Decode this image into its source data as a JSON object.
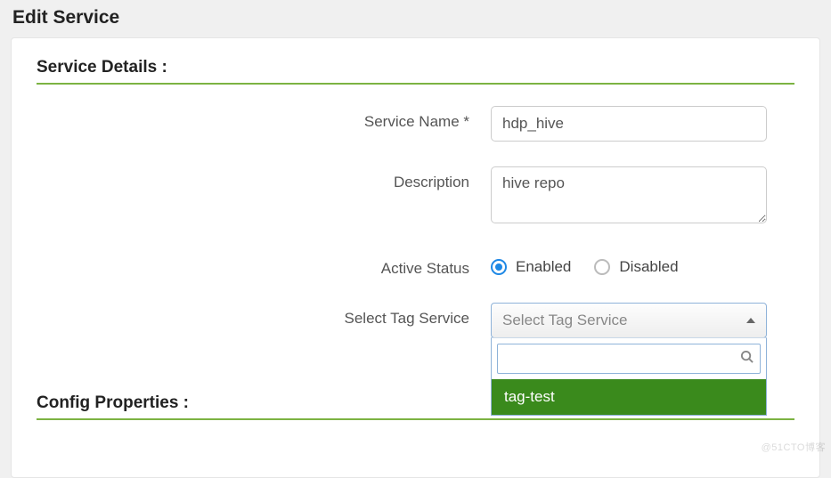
{
  "page": {
    "title": "Edit Service"
  },
  "sections": {
    "details_title": "Service Details :",
    "config_title": "Config Properties :"
  },
  "form": {
    "service_name": {
      "label": "Service Name *",
      "value": "hdp_hive"
    },
    "description": {
      "label": "Description",
      "value": "hive repo"
    },
    "active_status": {
      "label": "Active Status",
      "enabled_label": "Enabled",
      "disabled_label": "Disabled",
      "value": "enabled"
    },
    "tag_service": {
      "label": "Select Tag Service",
      "placeholder": "Select Tag Service",
      "search_value": "",
      "options": [
        "tag-test"
      ],
      "highlighted": "tag-test"
    }
  },
  "watermark": "@51CTO博客"
}
